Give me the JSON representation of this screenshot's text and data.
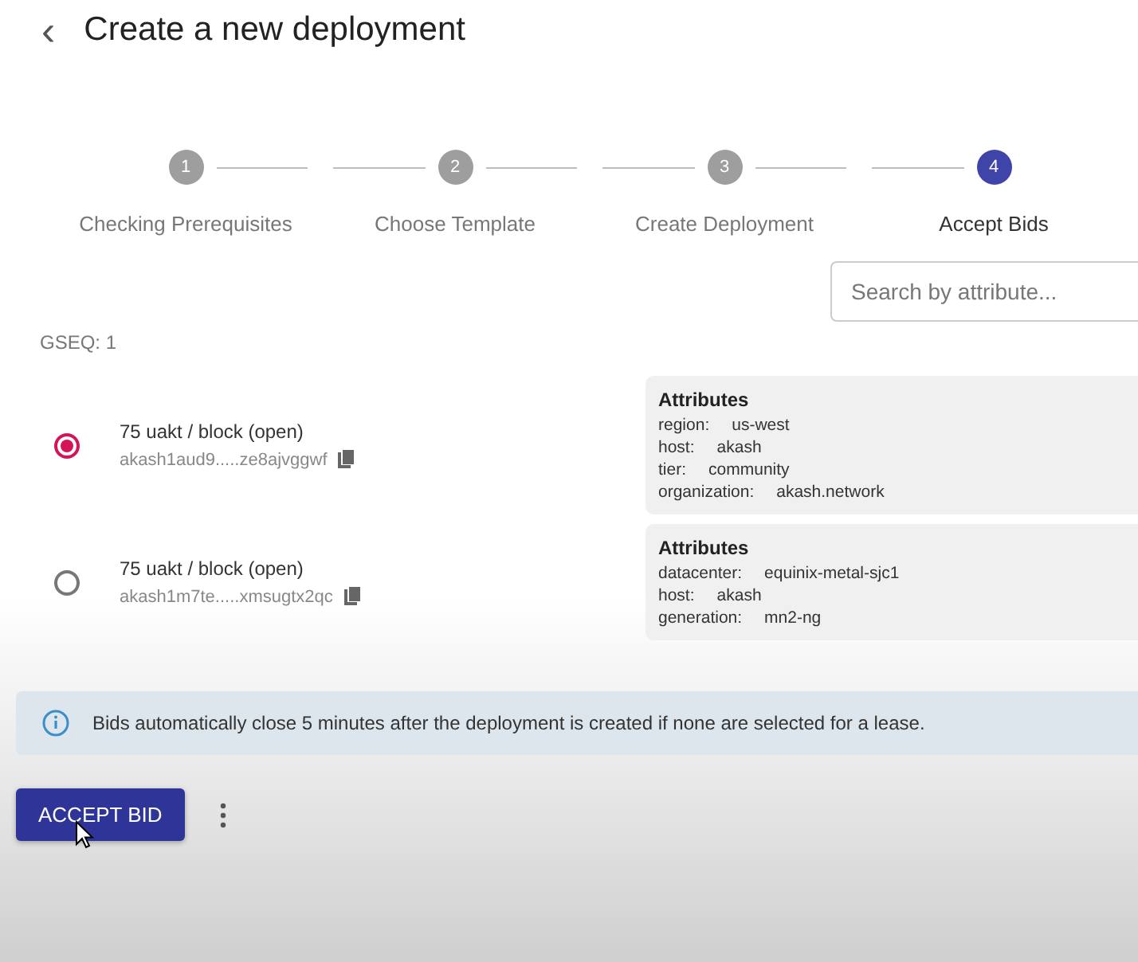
{
  "header": {
    "back": "‹",
    "title": "Create a new deployment"
  },
  "steps": [
    {
      "number": "1",
      "label": "Checking Prerequisites",
      "selected": false
    },
    {
      "number": "2",
      "label": "Choose Template",
      "selected": false
    },
    {
      "number": "3",
      "label": "Create Deployment",
      "selected": false
    },
    {
      "number": "4",
      "label": "Accept Bids",
      "selected": true
    }
  ],
  "search": {
    "placeholder": "Search by attribute..."
  },
  "gseq": "GSEQ: 1",
  "bids": [
    {
      "price": "75 uakt / block (open)",
      "address": "akash1aud9.....ze8ajvggwf",
      "selected": true,
      "attributes_title": "Attributes",
      "attributes": [
        {
          "key": "region:",
          "value": "us-west"
        },
        {
          "key": "host:",
          "value": "akash"
        },
        {
          "key": "tier:",
          "value": "community"
        },
        {
          "key": "organization:",
          "value": "akash.network"
        }
      ]
    },
    {
      "price": "75 uakt / block (open)",
      "address": "akash1m7te.....xmsugtx2qc",
      "selected": false,
      "attributes_title": "Attributes",
      "attributes": [
        {
          "key": "datacenter:",
          "value": "equinix-metal-sjc1"
        },
        {
          "key": "host:",
          "value": "akash"
        },
        {
          "key": "generation:",
          "value": "mn2-ng"
        }
      ]
    }
  ],
  "info": "Bids automatically close 5 minutes after the deployment is created if none are selected for a lease.",
  "accept_button": "ACCEPT BID"
}
